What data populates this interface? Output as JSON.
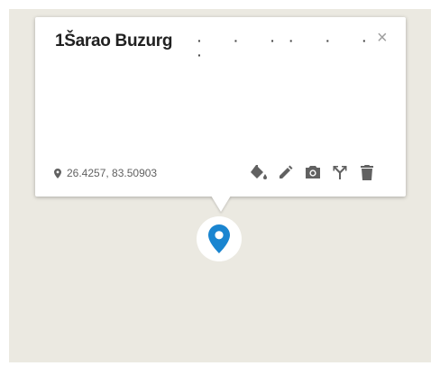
{
  "place": {
    "title": "1Šarao Buzurg",
    "subtitle_dots": "· · ·· · · ·",
    "coordinates": "26.4257, 83.50903"
  },
  "popup": {
    "close_glyph": "×"
  },
  "toolbar_icons": [
    "paint-bucket-icon",
    "pencil-icon",
    "camera-icon",
    "directions-icon",
    "trash-icon"
  ],
  "colors": {
    "map_background": "#ebe9e1",
    "marker": "#1a85d0",
    "icon": "#616161"
  }
}
